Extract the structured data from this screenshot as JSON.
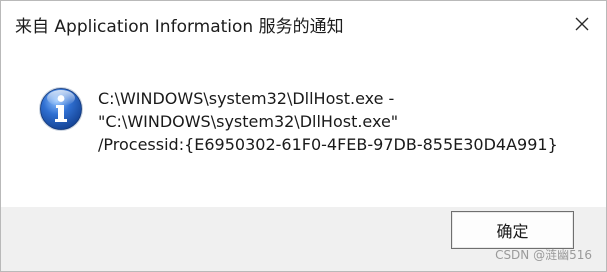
{
  "window": {
    "title": "来自 Application Information 服务的通知"
  },
  "titlebar": {
    "close_icon": "close-icon"
  },
  "message": {
    "icon": "info-icon",
    "lines": [
      "C:\\WINDOWS\\system32\\DllHost.exe -",
      "\"C:\\WINDOWS\\system32\\DllHost.exe\"",
      "/Processid:{E6950302-61F0-4FEB-97DB-855E30D4A991}"
    ]
  },
  "buttons": {
    "ok_label": "确定"
  },
  "watermark": {
    "text": "CSDN @涟幽516"
  },
  "colors": {
    "icon_blue": "#2f6fd1",
    "footer_bg": "#f0f0f0"
  }
}
